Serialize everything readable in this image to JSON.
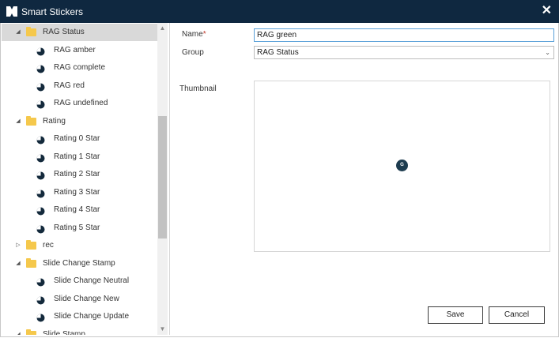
{
  "window": {
    "title": "Smart Stickers",
    "close_glyph": "✕"
  },
  "tree": [
    {
      "type": "group",
      "label": "RAG Status",
      "expanded": true,
      "selected": true
    },
    {
      "type": "item",
      "label": "RAG amber"
    },
    {
      "type": "item",
      "label": "RAG complete"
    },
    {
      "type": "item",
      "label": "RAG red"
    },
    {
      "type": "item",
      "label": "RAG undefined"
    },
    {
      "type": "group",
      "label": "Rating",
      "expanded": true
    },
    {
      "type": "item",
      "label": "Rating 0 Star"
    },
    {
      "type": "item",
      "label": "Rating 1 Star"
    },
    {
      "type": "item",
      "label": "Rating 2 Star"
    },
    {
      "type": "item",
      "label": "Rating 3 Star"
    },
    {
      "type": "item",
      "label": "Rating 4 Star"
    },
    {
      "type": "item",
      "label": "Rating 5 Star"
    },
    {
      "type": "group",
      "label": "rec",
      "expanded": false
    },
    {
      "type": "group",
      "label": "Slide Change Stamp",
      "expanded": true
    },
    {
      "type": "item",
      "label": "Slide Change Neutral"
    },
    {
      "type": "item",
      "label": "Slide Change New"
    },
    {
      "type": "item",
      "label": "Slide Change Update"
    },
    {
      "type": "group",
      "label": "Slide Stamp",
      "expanded": true
    }
  ],
  "form": {
    "name_label": "Name",
    "required_mark": "*",
    "name_value": "RAG green",
    "group_label": "Group",
    "group_value": "RAG Status",
    "thumbnail_label": "Thumbnail",
    "thumbnail_glyph": "G"
  },
  "buttons": {
    "save": "Save",
    "cancel": "Cancel"
  },
  "colors": {
    "titlebar": "#0f2840",
    "folder": "#f5c84c",
    "selection": "#d9d9d9",
    "sticker": "#1d3c4f",
    "pie": "#142a3c"
  }
}
